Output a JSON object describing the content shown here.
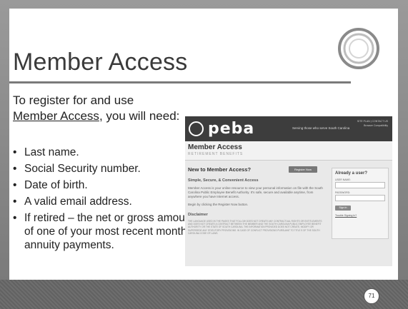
{
  "slide": {
    "title": "Member Access",
    "intro_prefix": "To register for and use",
    "intro_link": "Member Access",
    "intro_suffix": ", you will need:",
    "bullets": [
      "Last name.",
      "Social Security number.",
      "Date of birth.",
      "A valid email address.",
      "If retired – the net or gross amount of one of your most recent monthly annuity payments."
    ],
    "page_number": "71"
  },
  "website": {
    "logo_text": "peba",
    "tagline": "Serving those who serve South Carolina",
    "top_links": [
      "SITE PLAN | CONTACT US",
      "Browser Compatibility"
    ],
    "header_title": "Member Access",
    "header_subtitle": "RETIREMENT BENEFITS",
    "heading": "New to Member Access?",
    "register_button": "Register Now",
    "subheading": "Simple, Secure, & Convenient Access",
    "paragraph": "Member Access is your online resource to view your personal information on file with the South Carolina Public Employee Benefit Authority. It's safe, secure and available anytime, from anywhere you have Internet access.",
    "begin_text": "Begin by clicking the Register Now button.",
    "disclaimer_heading": "Disclaimer",
    "disclaimer_text": "THE LANGUAGE USED IN THE PAGES THAT FOLLOW DOES NOT CREATE ANY CONTRACTUAL RIGHTS OR ENTITLEMENTS AND DOES NOT CREATE A CONTRACT BETWEEN THE MEMBER AND THE SOUTH CAROLINA PUBLIC EMPLOYEE BENEFIT AUTHORITY OR THE STATE OF SOUTH CAROLINA. THE INFORMATION PROVIDED DOES NOT CREATE, MODIFY OR SUPERSEDE ANY STATUTORY PROVISIONS. IN CASE OF CONFLICT PROVISIONS PURSUANT TO TITLE 9 OF THE SOUTH CAROLINA CODE OF LAWS.",
    "login_title": "Already a user?",
    "username_label": "USER NAME:",
    "password_label": "PASSWORD:",
    "signin_button": "Sign In",
    "trouble_link": "Trouble Signing In?"
  }
}
